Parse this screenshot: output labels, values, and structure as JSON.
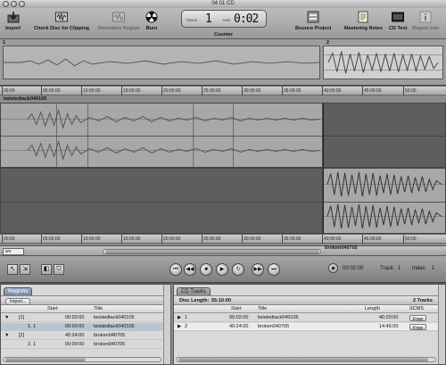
{
  "window": {
    "title": "04 01 CD"
  },
  "toolbar": {
    "import": "Import",
    "check_disc": "Check Disc for Clipping",
    "normalize": "Normalize Region",
    "burn": "Burn",
    "counter_caption": "Counter",
    "counter_track_label": "TRACK",
    "counter_track_value": "1",
    "counter_time_label": "TIME",
    "counter_time_value": "0:02",
    "bounce": "Bounce Project",
    "mastering_notes": "Mastering Notes",
    "cd_text": "CD Text",
    "region_info": "Region Info"
  },
  "overview": {
    "marker_1": "1",
    "marker_2": "2"
  },
  "timeline": {
    "ruler_top": [
      "00:00",
      "05:00:00",
      "10:00:00",
      "15:00:00",
      "20:00:00",
      "25:00:00",
      "30:00:00",
      "35:00:00",
      "40:00:00",
      "45:00:00",
      "50:00"
    ],
    "ruler_bottom": [
      "00:00",
      "05:00:00",
      "10:00:00",
      "15:00:00",
      "20:00:00",
      "25:00:00",
      "30:00:00",
      "35:00:00",
      "40:00:00",
      "45:00:00",
      "50:00"
    ],
    "region_top": "twistedtack040105",
    "region_bottom": "broken040705"
  },
  "zoom": {
    "value": "wo"
  },
  "transport": {
    "time": "00:02:00",
    "track_label": "Track:",
    "track_value": "1",
    "index_label": "Index:",
    "index_value": "1"
  },
  "regions_pane": {
    "tab": "Regions",
    "import_button": "Import...",
    "columns": [
      "Start",
      "Title"
    ],
    "rows": [
      {
        "expander": "▼",
        "index": "[1]",
        "start": "00:02:00",
        "title": "twistedtack040105"
      },
      {
        "expander": "",
        "index": "1. 1",
        "start": "00:00:00",
        "title": "twistedtack040105"
      },
      {
        "expander": "▼",
        "index": "[2]",
        "start": "40:24:00",
        "title": "broken040705"
      },
      {
        "expander": "",
        "index": "2. 1",
        "start": "00:00:00",
        "title": "broken040705"
      }
    ]
  },
  "cd_pane": {
    "tab": "CD Tracks",
    "disc_length_label": "Disc Length:",
    "disc_length_value": "55:10:00",
    "track_count": "2 Tracks",
    "columns": [
      "Start",
      "Title",
      "Length",
      "SCMS"
    ],
    "rows": [
      {
        "index": "1",
        "start": "00:02:00",
        "title": "twistedtack040105",
        "length": "40:20:00",
        "scms": "Free"
      },
      {
        "index": "2",
        "start": "40:24:00",
        "title": "broken040705",
        "length": "14:46:00",
        "scms": "Free"
      }
    ]
  }
}
